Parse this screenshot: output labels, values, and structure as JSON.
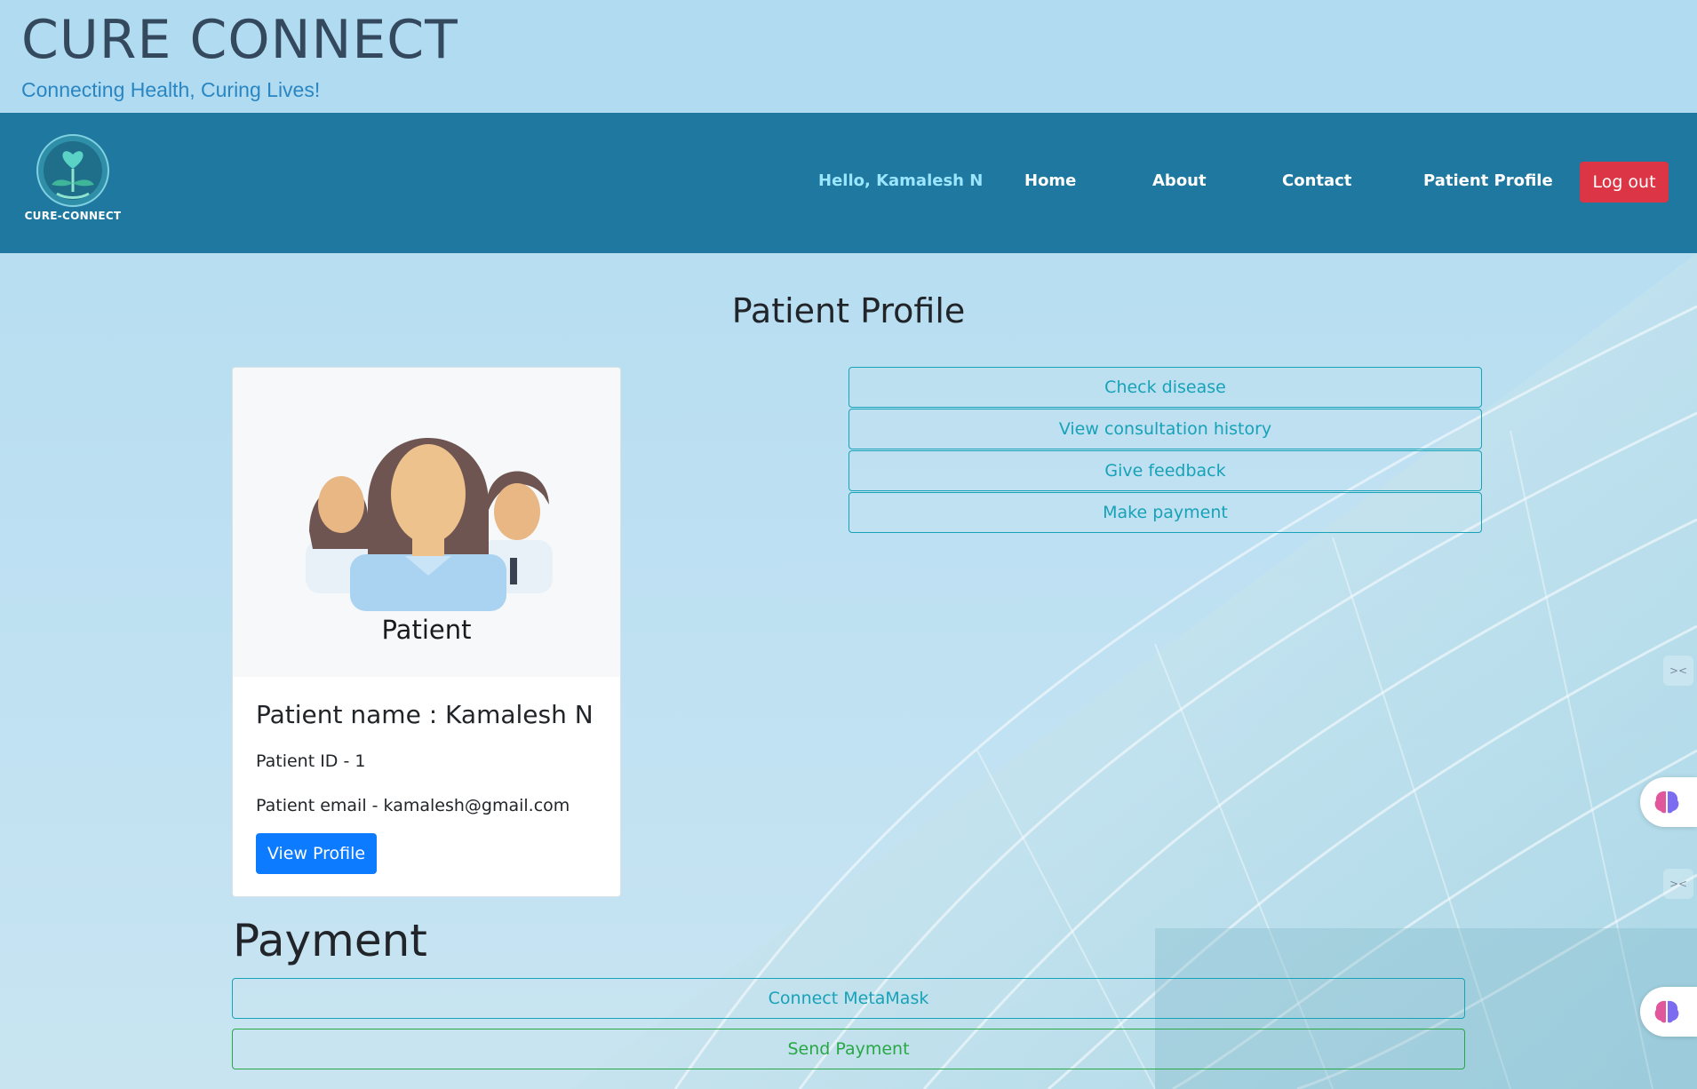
{
  "banner": {
    "title": "CURE CONNECT",
    "tagline": "Connecting Health, Curing Lives!"
  },
  "navbar": {
    "logo_text": "CURE-CONNECT",
    "greeting": "Hello, Kamalesh N",
    "links": [
      {
        "label": "Home"
      },
      {
        "label": "About"
      },
      {
        "label": "Contact"
      },
      {
        "label": "Patient Profile"
      }
    ],
    "logout_label": "Log out"
  },
  "page": {
    "title": "Patient Profile"
  },
  "card": {
    "image_caption": "Patient",
    "name": "Patient name : Kamalesh N",
    "id_line": "Patient ID - 1",
    "email_line": "Patient email - kamalesh@gmail.com",
    "view_button": "View Profile"
  },
  "actions": [
    {
      "label": "Check disease"
    },
    {
      "label": "View consultation history"
    },
    {
      "label": "Give feedback"
    },
    {
      "label": "Make payment"
    }
  ],
  "payment": {
    "title": "Payment",
    "connect_label": "Connect MetaMask",
    "send_label": "Send Payment"
  },
  "colors": {
    "navbar": "#1e789f",
    "logout": "#dc3545",
    "primary": "#0d7bff",
    "info": "#17a2b8",
    "success": "#28a745"
  },
  "icons": [
    "logo-icon",
    "patients-illustration",
    "brain-icon"
  ]
}
